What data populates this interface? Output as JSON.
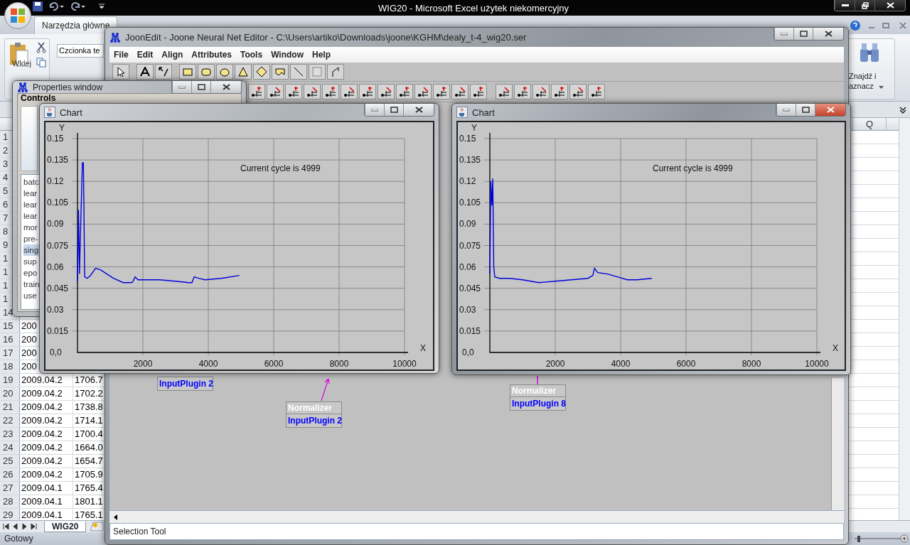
{
  "excel": {
    "title": "WIG20  -  Microsoft Excel użytek niekomercyjny",
    "ribbon_tabs": [
      {
        "label": "Narzędzia główne",
        "selected": true
      }
    ],
    "paste_label": "Wklej",
    "font_field": "Czcionka te",
    "find_label": [
      "Znajdź i",
      "aznacz"
    ],
    "column_header": "Q",
    "rows": [
      {
        "number": "1",
        "cells": []
      },
      {
        "number": "2",
        "cells": []
      },
      {
        "number": "3",
        "cells": []
      },
      {
        "number": "4",
        "cells": []
      },
      {
        "number": "5",
        "cells": []
      },
      {
        "number": "6",
        "cells": []
      },
      {
        "number": "7",
        "cells": []
      },
      {
        "number": "8",
        "cells": []
      },
      {
        "number": "9",
        "cells": []
      },
      {
        "number": "1",
        "cells": []
      },
      {
        "number": "1",
        "cells": []
      },
      {
        "number": "1",
        "cells": []
      },
      {
        "number": "1",
        "cells": []
      },
      {
        "number": "14",
        "cells": []
      },
      {
        "number": "15",
        "cells": [
          "200"
        ]
      },
      {
        "number": "16",
        "cells": [
          "200"
        ]
      },
      {
        "number": "17",
        "cells": [
          "200"
        ]
      },
      {
        "number": "18",
        "cells": [
          "200"
        ]
      },
      {
        "number": "19",
        "cells": [
          "2009.04.2",
          "1706.7"
        ]
      },
      {
        "number": "20",
        "cells": [
          "2009.04.2",
          "1702.2"
        ]
      },
      {
        "number": "21",
        "cells": [
          "2009.04.2",
          "1738.8"
        ]
      },
      {
        "number": "22",
        "cells": [
          "2009.04.2",
          "1714.1"
        ]
      },
      {
        "number": "23",
        "cells": [
          "2009.04.2",
          "1700.4"
        ]
      },
      {
        "number": "24",
        "cells": [
          "2009.04.2",
          "1664.0"
        ]
      },
      {
        "number": "25",
        "cells": [
          "2009.04.2",
          "1654.7"
        ]
      },
      {
        "number": "26",
        "cells": [
          "2009.04.2",
          "1705.9"
        ]
      },
      {
        "number": "27",
        "cells": [
          "2009.04.1",
          "1765.4"
        ]
      },
      {
        "number": "28",
        "cells": [
          "2009.04.1",
          "1801.1"
        ]
      },
      {
        "number": "29",
        "cells": [
          "2009.04.1",
          "1765.1"
        ]
      }
    ],
    "sheet_tabs": [
      {
        "label": "WIG20",
        "selected": true
      }
    ],
    "status": "Gotowy"
  },
  "properties_window": {
    "title": "Properties window",
    "group": "Controls",
    "items": [
      {
        "label": "batc",
        "selected": false
      },
      {
        "label": "lear",
        "selected": false
      },
      {
        "label": "lear",
        "selected": false
      },
      {
        "label": "lear",
        "selected": false
      },
      {
        "label": "mor",
        "selected": false
      },
      {
        "label": "pre-",
        "selected": false
      },
      {
        "label": "sing",
        "selected": true
      },
      {
        "label": "sup",
        "selected": false
      },
      {
        "label": "epo",
        "selected": false
      },
      {
        "label": "train",
        "selected": false
      },
      {
        "label": "use",
        "selected": false
      }
    ]
  },
  "editor": {
    "title": "JoonEdit - Joone Neural Net Editor - C:\\Users\\artiko\\Downloads\\joone\\KGHM\\dealy_t-4_wig20.ser",
    "menu": [
      "File",
      "Edit",
      "Align",
      "Attributes",
      "Tools",
      "Window",
      "Help"
    ],
    "nodes": [
      {
        "label": "InputPlugin 2"
      },
      {
        "header": "Normalizer",
        "label": "InputPlugin 2"
      },
      {
        "header": "Normalizer",
        "label": "InputPlugin 8"
      }
    ],
    "status": "Selection Tool"
  },
  "charts": [
    {
      "title": "Chart",
      "caption": "Current cycle is 4999",
      "active": false,
      "chart_data": {
        "type": "line",
        "grid": true,
        "xlabel": "X",
        "ylabel": "Y",
        "xlim": [
          0,
          10000
        ],
        "ylim": [
          0,
          0.15
        ],
        "xticks": [
          2000,
          4000,
          6000,
          8000,
          10000
        ],
        "yticks": [
          {
            "value": 0,
            "label": "0,0"
          },
          0.015,
          0.03,
          0.045,
          0.06,
          0.075,
          0.09,
          0.105,
          0.12,
          0.135,
          0.15
        ],
        "x": [
          0,
          30,
          60,
          90,
          120,
          150,
          180,
          220,
          300,
          400,
          550,
          700,
          900,
          1100,
          1400,
          1650,
          1700,
          1760,
          1850,
          2500,
          3000,
          3400,
          3500,
          3570,
          3700,
          3900,
          4400,
          4950
        ],
        "series": [
          {
            "color": "#0000dd",
            "values": [
              0.05,
              0.1,
              0.055,
              0.082,
              0.107,
              0.133,
              0.133,
              0.053,
              0.052,
              0.054,
              0.059,
              0.058,
              0.055,
              0.052,
              0.049,
              0.049,
              0.05,
              0.053,
              0.051,
              0.051,
              0.05,
              0.049,
              0.049,
              0.053,
              0.052,
              0.051,
              0.052,
              0.054
            ]
          }
        ]
      }
    },
    {
      "title": "Chart",
      "caption": "Current cycle is 4999",
      "active": true,
      "chart_data": {
        "type": "line",
        "grid": true,
        "xlabel": "X",
        "ylabel": "Y",
        "xlim": [
          0,
          10000
        ],
        "ylim": [
          0,
          0.15
        ],
        "xticks": [
          2000,
          4000,
          6000,
          8000,
          10000
        ],
        "yticks": [
          {
            "value": 0,
            "label": "0,0"
          },
          0.015,
          0.03,
          0.045,
          0.06,
          0.075,
          0.09,
          0.105,
          0.12,
          0.135,
          0.15
        ],
        "x": [
          0,
          30,
          60,
          90,
          120,
          150,
          300,
          600,
          1000,
          1500,
          2000,
          2500,
          3000,
          3150,
          3200,
          3300,
          3600,
          3900,
          4200,
          4500,
          4950
        ],
        "series": [
          {
            "color": "#0000dd",
            "values": [
              0.055,
              0.12,
              0.103,
              0.122,
              0.06,
              0.053,
              0.052,
              0.052,
              0.051,
              0.049,
              0.05,
              0.051,
              0.052,
              0.054,
              0.059,
              0.056,
              0.055,
              0.053,
              0.051,
              0.051,
              0.052
            ]
          }
        ]
      }
    }
  ]
}
